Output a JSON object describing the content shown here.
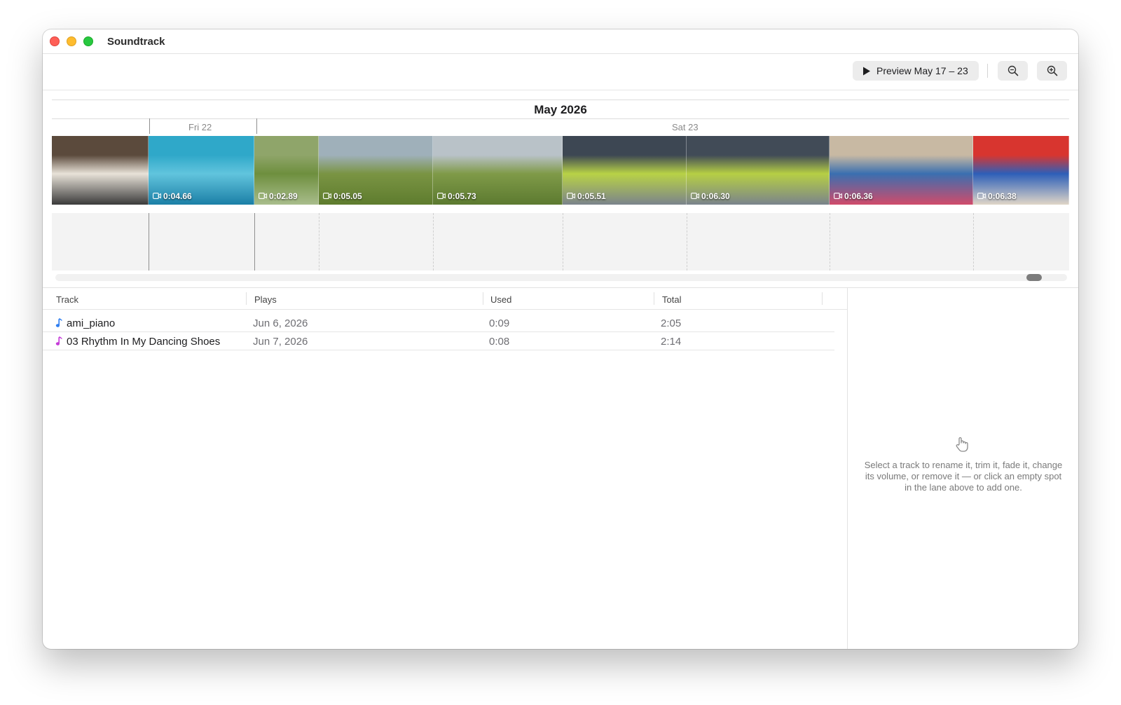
{
  "window": {
    "title": "Soundtrack"
  },
  "toolbar": {
    "preview_label": "Preview May 17 – 23",
    "zoom_out_icon": "zoom-out-icon",
    "zoom_in_icon": "zoom-in-icon"
  },
  "timeline": {
    "month": "May 2026",
    "days": [
      {
        "label": "Fri 22"
      },
      {
        "label": "Sat 23"
      }
    ],
    "clips": [
      {
        "duration": "",
        "colors": [
          "#5b4a3c",
          "#e8e2d8",
          "#3a3a3a"
        ]
      },
      {
        "duration": "0:04.66",
        "colors": [
          "#2fa8c9",
          "#61c4dd",
          "#1b7fa6"
        ]
      },
      {
        "duration": "0:02.89",
        "colors": [
          "#8fa56a",
          "#6e8f3e",
          "#a9bd8c"
        ]
      },
      {
        "duration": "0:05.05",
        "colors": [
          "#9fb0ba",
          "#7a9443",
          "#5e7c2e"
        ]
      },
      {
        "duration": "0:05.73",
        "colors": [
          "#b9c2c8",
          "#7f9a48",
          "#5c7a30"
        ]
      },
      {
        "duration": "0:05.51",
        "colors": [
          "#3d4753",
          "#b8d246",
          "#7b838c"
        ]
      },
      {
        "duration": "0:06.30",
        "colors": [
          "#414b57",
          "#b6cf44",
          "#7a838c"
        ]
      },
      {
        "duration": "0:06.36",
        "colors": [
          "#c8b9a3",
          "#3a6fb0",
          "#d14b6a"
        ]
      },
      {
        "duration": "0:06.38",
        "colors": [
          "#d8352f",
          "#2d5fb8",
          "#e0d6c7"
        ]
      }
    ]
  },
  "tracks": {
    "columns": [
      "Track",
      "Plays",
      "Used",
      "Total"
    ],
    "rows": [
      {
        "name": "ami_piano",
        "plays": "Jun 6, 2026",
        "used": "0:09",
        "total": "2:05",
        "note_color": "#2f7ef0"
      },
      {
        "name": "03 Rhythm In My Dancing Shoes",
        "plays": "Jun 7, 2026",
        "used": "0:08",
        "total": "2:14",
        "note_color": "#c53bd8"
      }
    ]
  },
  "inspector": {
    "icon": "hand-pointer-icon",
    "text": "Select a track to rename it, trim it, fade it, change its volume, or remove it — or click an empty spot in the lane above to add one."
  }
}
